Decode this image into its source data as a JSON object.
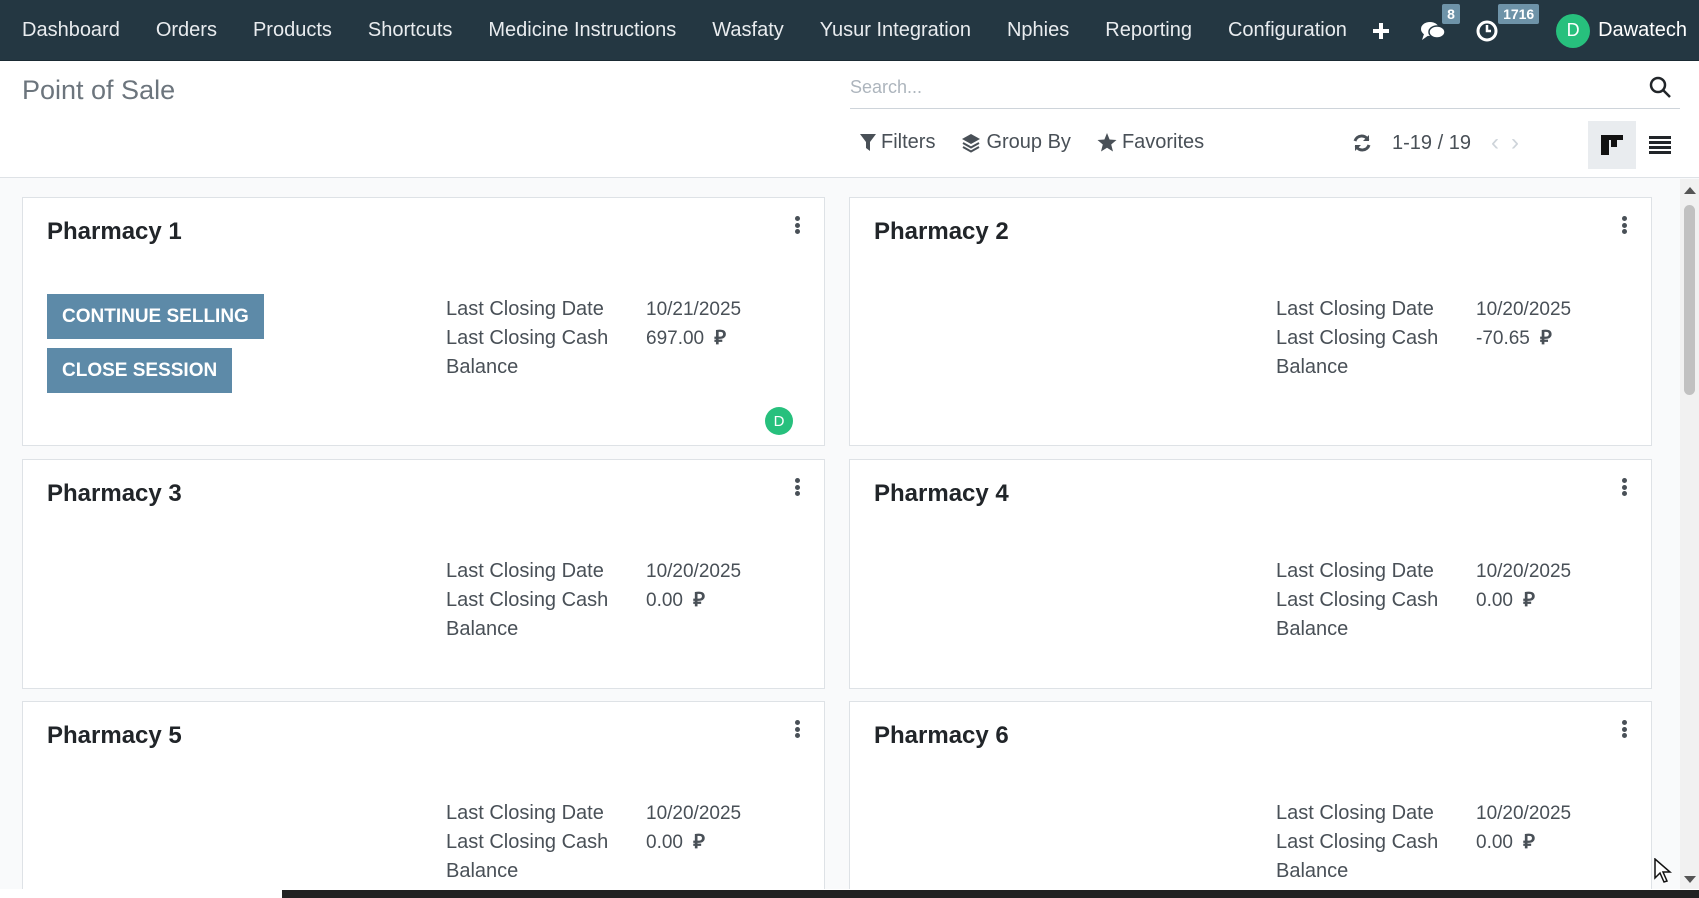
{
  "navbar": {
    "items": [
      "Dashboard",
      "Orders",
      "Products",
      "Shortcuts",
      "Medicine Instructions",
      "Wasfaty",
      "Yusur Integration",
      "Nphies",
      "Reporting",
      "Configuration"
    ],
    "messages_count": "8",
    "activities_count": "1716",
    "user_initial": "D",
    "user_name": "Dawatech"
  },
  "control_panel": {
    "title": "Point of Sale",
    "search_placeholder": "Search...",
    "filters_label": "Filters",
    "groupby_label": "Group By",
    "favorites_label": "Favorites",
    "pager": "1-19 / 19"
  },
  "labels": {
    "last_closing_date": "Last Closing Date",
    "last_closing_cash": "Last Closing Cash",
    "balance": "Balance",
    "currency_symbol": "⃁"
  },
  "cards": [
    {
      "name": "Pharmacy 1",
      "continue_label": "CONTINUE SELLING",
      "close_label": "CLOSE SESSION",
      "date": "10/21/2025",
      "cash": "697.00",
      "avatar": "D"
    },
    {
      "name": "Pharmacy 2",
      "date": "10/20/2025",
      "cash": "-70.65"
    },
    {
      "name": "Pharmacy 3",
      "date": "10/20/2025",
      "cash": "0.00"
    },
    {
      "name": "Pharmacy 4",
      "date": "10/20/2025",
      "cash": "0.00"
    },
    {
      "name": "Pharmacy 5",
      "date": "10/20/2025",
      "cash": "0.00"
    },
    {
      "name": "Pharmacy 6",
      "date": "10/20/2025",
      "cash": "0.00"
    }
  ],
  "colors": {
    "navbar": "#243742",
    "primary_button": "#5d8aa8",
    "avatar": "#27c07d",
    "badge": "#6e93a8"
  }
}
